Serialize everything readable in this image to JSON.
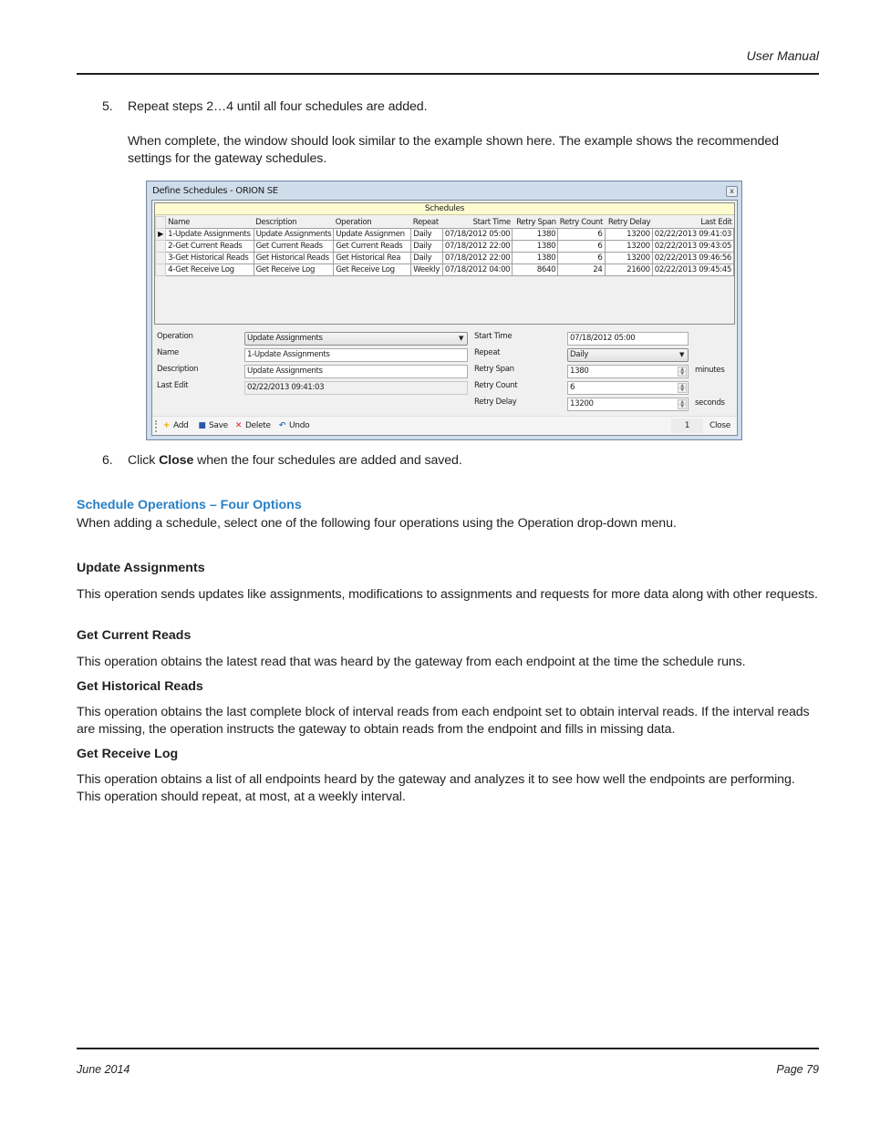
{
  "header": {
    "title": "User Manual"
  },
  "steps": {
    "step5": {
      "number": "5.",
      "text": "Repeat steps 2…4 until all four schedules are added.",
      "para": "When complete, the window should look similar to the example shown here. The example shows the recommended settings for the gateway schedules."
    },
    "step6": {
      "number": "6.",
      "pre": "Click ",
      "bold": "Close",
      "post": " when the four schedules are added and saved."
    }
  },
  "window": {
    "title": "Define Schedules - ORION SE",
    "close_glyph": "x",
    "grid": {
      "caption": "Schedules",
      "columns": [
        "Name",
        "Description",
        "Operation",
        "Repeat",
        "Start Time",
        "Retry Span",
        "Retry Count",
        "Retry Delay",
        "Last Edit"
      ],
      "selected_row_marker": "▶",
      "rows": [
        [
          "1-Update Assignments",
          "Update Assignments",
          "Update Assignmen",
          "Daily",
          "07/18/2012 05:00",
          "1380",
          "6",
          "13200",
          "02/22/2013 09:41:03"
        ],
        [
          "2-Get Current Reads",
          "Get Current Reads",
          "Get Current Reads",
          "Daily",
          "07/18/2012 22:00",
          "1380",
          "6",
          "13200",
          "02/22/2013 09:43:05"
        ],
        [
          "3-Get Historical Reads",
          "Get Historical Reads",
          "Get Historical Rea",
          "Daily",
          "07/18/2012 22:00",
          "1380",
          "6",
          "13200",
          "02/22/2013 09:46:56"
        ],
        [
          "4-Get Receive Log",
          "Get Receive Log",
          "Get Receive Log",
          "Weekly",
          "07/18/2012 04:00",
          "8640",
          "24",
          "21600",
          "02/22/2013 09:45:45"
        ]
      ]
    },
    "form": {
      "operation_label": "Operation",
      "operation_value": "Update Assignments",
      "name_label": "Name",
      "name_value": "1-Update Assignments",
      "description_label": "Description",
      "description_value": "Update Assignments",
      "last_edit_label": "Last Edit",
      "last_edit_value": "02/22/2013 09:41:03",
      "start_time_label": "Start Time",
      "start_time_value": "07/18/2012 05:00",
      "repeat_label": "Repeat",
      "repeat_value": "Daily",
      "retry_span_label": "Retry Span",
      "retry_span_value": "1380",
      "retry_span_unit": "minutes",
      "retry_count_label": "Retry Count",
      "retry_count_value": "6",
      "retry_delay_label": "Retry Delay",
      "retry_delay_value": "13200",
      "retry_delay_unit": "seconds",
      "combo_arrow": "▼",
      "spin_up": "▲",
      "spin_down": "▼"
    },
    "toolbar": {
      "add_icon": "+",
      "add_label": "Add",
      "save_icon": "■",
      "save_label": "Save",
      "delete_icon": "✕",
      "delete_label": "Delete",
      "undo_icon": "↶",
      "undo_label": "Undo",
      "page_number": "1",
      "close_label": "Close"
    }
  },
  "section": {
    "subheading": "Schedule Operations – Four Options",
    "intro": "When adding a schedule, select one of the following four operations using the Operation drop-down menu.",
    "operations": [
      {
        "title": "Update Assignments",
        "text": "This operation sends updates like assignments, modifications to assignments and requests for more data along with other requests."
      },
      {
        "title": "Get Current Reads",
        "text": "This operation obtains the latest read that was heard by the gateway from each endpoint at the time the schedule runs."
      },
      {
        "title": "Get Historical Reads",
        "text": "This operation obtains the last complete block of interval reads from each endpoint set to obtain interval reads. If the interval reads are missing, the operation instructs the gateway to obtain reads from the endpoint and fills in missing data."
      },
      {
        "title": "Get Receive Log",
        "text": "This operation obtains a list of all endpoints heard by the gateway and analyzes it to see how well the endpoints are performing. This operation should repeat, at most, at a weekly interval."
      }
    ]
  },
  "footer": {
    "date": "June 2014",
    "page": "Page 79"
  },
  "colors": {
    "subheading": "#2780c6",
    "grid_caption_bg": "#fefbd0",
    "window_frame": "#b9d1ea",
    "delete_icon": "#e02020",
    "add_icon": "#e8a800",
    "save_icon": "#2a5aa8",
    "undo_icon": "#2a6ad0"
  }
}
